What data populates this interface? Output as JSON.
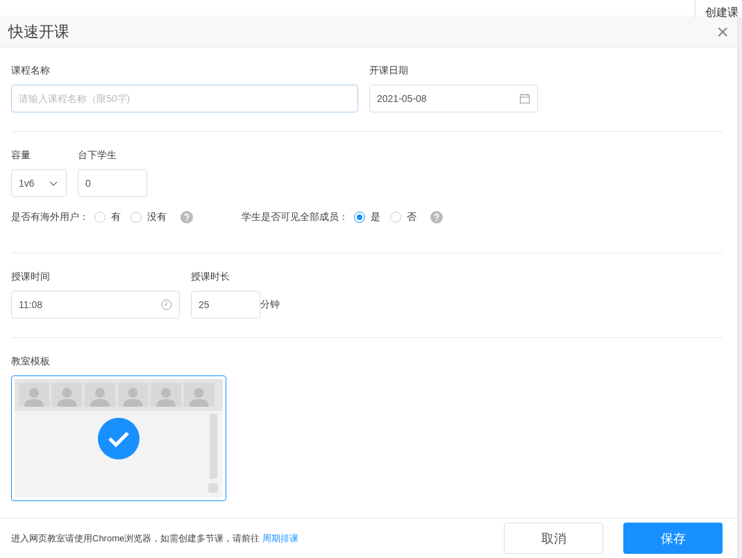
{
  "background": {
    "button": "创建课"
  },
  "dialog": {
    "title": "快速开课",
    "close": "×"
  },
  "course_name": {
    "label": "课程名称",
    "placeholder": "请输入课程名称（限50字)"
  },
  "start_date": {
    "label": "开课日期",
    "value": "2021-05-08"
  },
  "capacity": {
    "label": "容量",
    "value": "1v6"
  },
  "audience": {
    "label": "台下学生",
    "value": "0"
  },
  "radio_groups": [
    {
      "label": "是否有海外用户：",
      "options": [
        {
          "label": "有",
          "selected": false
        },
        {
          "label": "没有",
          "selected": false
        }
      ]
    },
    {
      "label": "学生是否可见全部成员：",
      "options": [
        {
          "label": "是",
          "selected": true
        },
        {
          "label": "否",
          "selected": false
        }
      ]
    }
  ],
  "class_time": {
    "label": "授课时间",
    "value": "11:08"
  },
  "duration": {
    "label": "授课时长",
    "value": "25",
    "unit": "分钟"
  },
  "template": {
    "label": "教室模板",
    "selected": true
  },
  "footer": {
    "note": "进入网页教室请使用Chrome浏览器，如需创建多节课，请前往",
    "link": "周期排课",
    "cancel": "取消",
    "save": "保存"
  }
}
